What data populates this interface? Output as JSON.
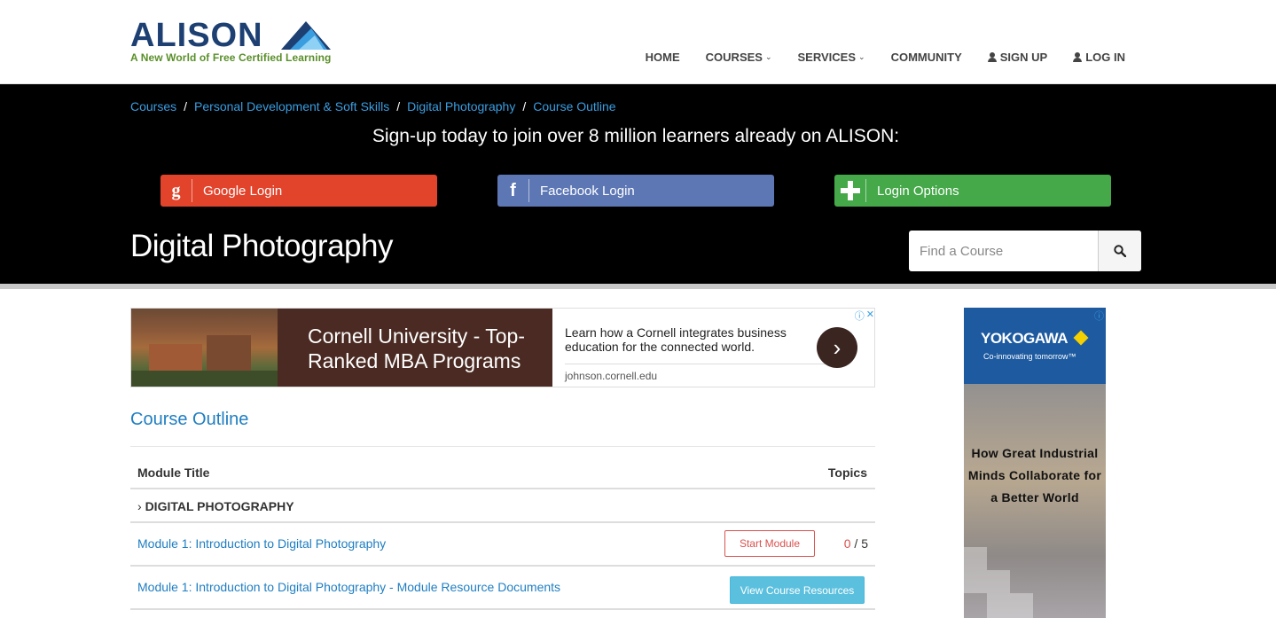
{
  "brand": {
    "name": "ALISON",
    "tagline": "A New World of Free Certified Learning"
  },
  "nav": {
    "home": "HOME",
    "courses": "COURSES",
    "services": "SERVICES",
    "community": "COMMUNITY",
    "signup": "SIGN UP",
    "login": "LOG IN"
  },
  "breadcrumb": [
    "Courses",
    "Personal Development & Soft Skills",
    "Digital Photography",
    "Course Outline"
  ],
  "signup_banner": "Sign-up today to join over 8 million learners already on ALISON:",
  "login_buttons": {
    "google": "Google Login",
    "facebook": "Facebook Login",
    "options": "Login Options"
  },
  "page_title": "Digital Photography",
  "search": {
    "placeholder": "Find a Course"
  },
  "ad": {
    "headline": "Cornell University - Top-Ranked MBA Programs",
    "description": "Learn how a Cornell integrates business education for the connected world.",
    "url": "johnson.cornell.edu"
  },
  "outline": {
    "title": "Course Outline",
    "col_module": "Module Title",
    "col_topics": "Topics",
    "section": "DIGITAL PHOTOGRAPHY",
    "rows": [
      {
        "title": "Module 1: Introduction to Digital Photography",
        "action": "Start Module",
        "done": "0",
        "total": "/ 5"
      },
      {
        "title": "Module 1: Introduction to Digital Photography - Module Resource Documents",
        "action": "View Course Resources"
      }
    ]
  },
  "side_ad": {
    "brand": "YOKOGAWA",
    "tagline": "Co-innovating tomorrow™",
    "message": "How Great Industrial Minds Collaborate for a Better World"
  },
  "colors": {
    "google": "#e2432b",
    "facebook": "#5d77b5",
    "options": "#45a849",
    "link": "#1f7ec2",
    "start": "#d9534f",
    "resources": "#5bc0de"
  }
}
